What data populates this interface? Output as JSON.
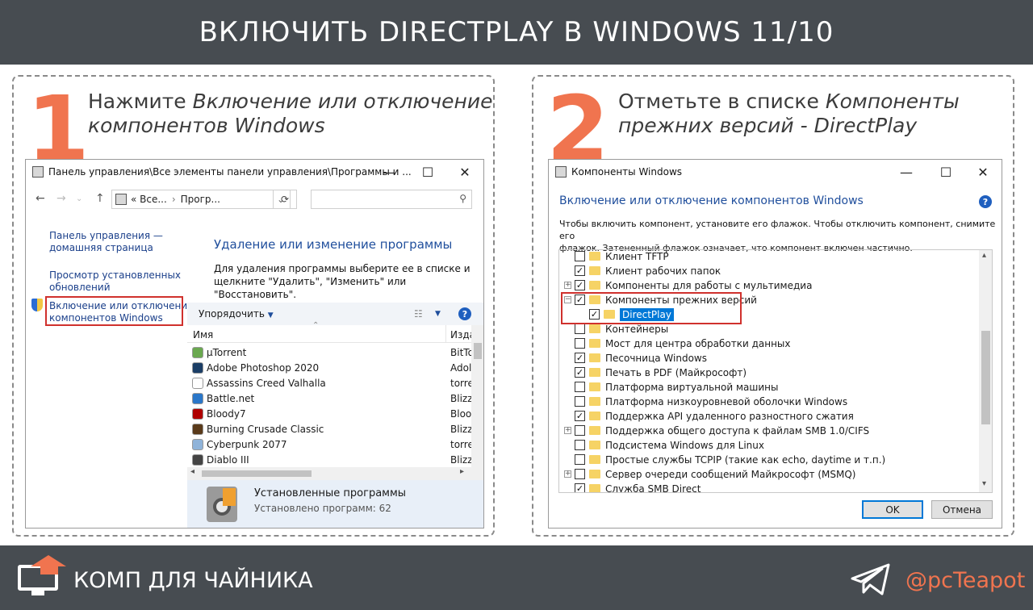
{
  "header": {
    "title": "ВКЛЮЧИТЬ DIRECTPLAY В WINDOWS 11/10"
  },
  "step1": {
    "number": "1",
    "text_plain": "Нажмите ",
    "text_italic_1": "Включение или отключение",
    "text_italic_2": "компонентов Windows",
    "window": {
      "title": "Панель управления\\Все элементы панели управления\\Программы и ...",
      "controls": {
        "minimize": "—",
        "maximize": "☐",
        "close": "✕"
      },
      "address": {
        "seg1": "« Все...",
        "sep": "›",
        "seg2": "Прогр..."
      },
      "left_links": {
        "home_1": "Панель управления —",
        "home_2": "домашняя страница",
        "updates_1": "Просмотр установленных",
        "updates_2": "обновлений",
        "features_1": "Включение или отключение",
        "features_2": "компонентов Windows"
      },
      "heading": "Удаление или изменение программы",
      "desc_1": "Для удаления программы выберите ее в списке и",
      "desc_2": "щелкните \"Удалить\", \"Изменить\" или \"Восстановить\".",
      "organize": "Упорядочить",
      "help": "?",
      "col_name": "Имя",
      "col_pub": "Изда",
      "programs": [
        {
          "name": "µTorrent",
          "pub": "BitTo",
          "color": "#6aa84f"
        },
        {
          "name": "Adobe Photoshop 2020",
          "pub": "Adol",
          "color": "#1b3e66"
        },
        {
          "name": "Assassins Creed Valhalla",
          "pub": "torre",
          "color": "#ffffff"
        },
        {
          "name": "Battle.net",
          "pub": "Blizz",
          "color": "#2a77c9"
        },
        {
          "name": "Bloody7",
          "pub": "Bloo",
          "color": "#b00000"
        },
        {
          "name": "Burning Crusade Classic",
          "pub": "Blizz",
          "color": "#5a3a1a"
        },
        {
          "name": "Cyberpunk 2077",
          "pub": "torre",
          "color": "#8fb3d9"
        },
        {
          "name": "Diablo III",
          "pub": "Blizz",
          "color": "#444444"
        }
      ],
      "status_title": "Установленные программы",
      "status_count": "Установлено программ: 62"
    }
  },
  "step2": {
    "number": "2",
    "text_plain": "Отметьте в списке ",
    "text_italic_1": "Компоненты",
    "text_italic_2": "прежних версий - DirectPlay",
    "window": {
      "title": "Компоненты Windows",
      "heading": "Включение или отключение компонентов Windows",
      "help": "?",
      "desc_1": "Чтобы включить компонент, установите его флажок. Чтобы отключить компонент, снимите его",
      "desc_2": "флажок. Затененный флажок означает, что компонент включен частично.",
      "features": [
        {
          "label": "Клиент TFTP",
          "checked": false,
          "expander": "",
          "indent": 0
        },
        {
          "label": "Клиент рабочих папок",
          "checked": true,
          "expander": "",
          "indent": 0
        },
        {
          "label": "Компоненты для работы с мультимедиа",
          "checked": true,
          "expander": "+",
          "indent": 0
        },
        {
          "label": "Компоненты прежних версий",
          "checked": true,
          "expander": "−",
          "indent": 0
        },
        {
          "label": "DirectPlay",
          "checked": true,
          "expander": "",
          "indent": 1,
          "selected": true
        },
        {
          "label": "Контейнеры",
          "checked": false,
          "expander": "",
          "indent": 0
        },
        {
          "label": "Мост для центра обработки данных",
          "checked": false,
          "expander": "",
          "indent": 0
        },
        {
          "label": "Песочница Windows",
          "checked": true,
          "expander": "",
          "indent": 0
        },
        {
          "label": "Печать в PDF (Майкрософт)",
          "checked": true,
          "expander": "",
          "indent": 0
        },
        {
          "label": "Платформа виртуальной машины",
          "checked": false,
          "expander": "",
          "indent": 0
        },
        {
          "label": "Платформа низкоуровневой оболочки Windows",
          "checked": false,
          "expander": "",
          "indent": 0
        },
        {
          "label": "Поддержка API удаленного разностного сжатия",
          "checked": true,
          "expander": "",
          "indent": 0
        },
        {
          "label": "Поддержка общего доступа к файлам SMB 1.0/CIFS",
          "checked": false,
          "expander": "+",
          "indent": 0
        },
        {
          "label": "Подсистема Windows для Linux",
          "checked": false,
          "expander": "",
          "indent": 0
        },
        {
          "label": "Простые службы TCPIP (такие как echo, daytime и т.п.)",
          "checked": false,
          "expander": "",
          "indent": 0
        },
        {
          "label": "Сервер очереди сообщений Майкрософт (MSMQ)",
          "checked": false,
          "expander": "+",
          "indent": 0
        },
        {
          "label": "Служба SMB Direct",
          "checked": true,
          "expander": "",
          "indent": 0
        }
      ],
      "ok": "OK",
      "cancel": "Отмена"
    }
  },
  "footer": {
    "brand": "КОМП ДЛЯ ЧАЙНИКА",
    "handle": "@pcTeapot"
  },
  "colors": {
    "accent": "#f0744f",
    "bar": "#474c51",
    "link": "#1a3f8a",
    "highlight": "#d0312d"
  }
}
